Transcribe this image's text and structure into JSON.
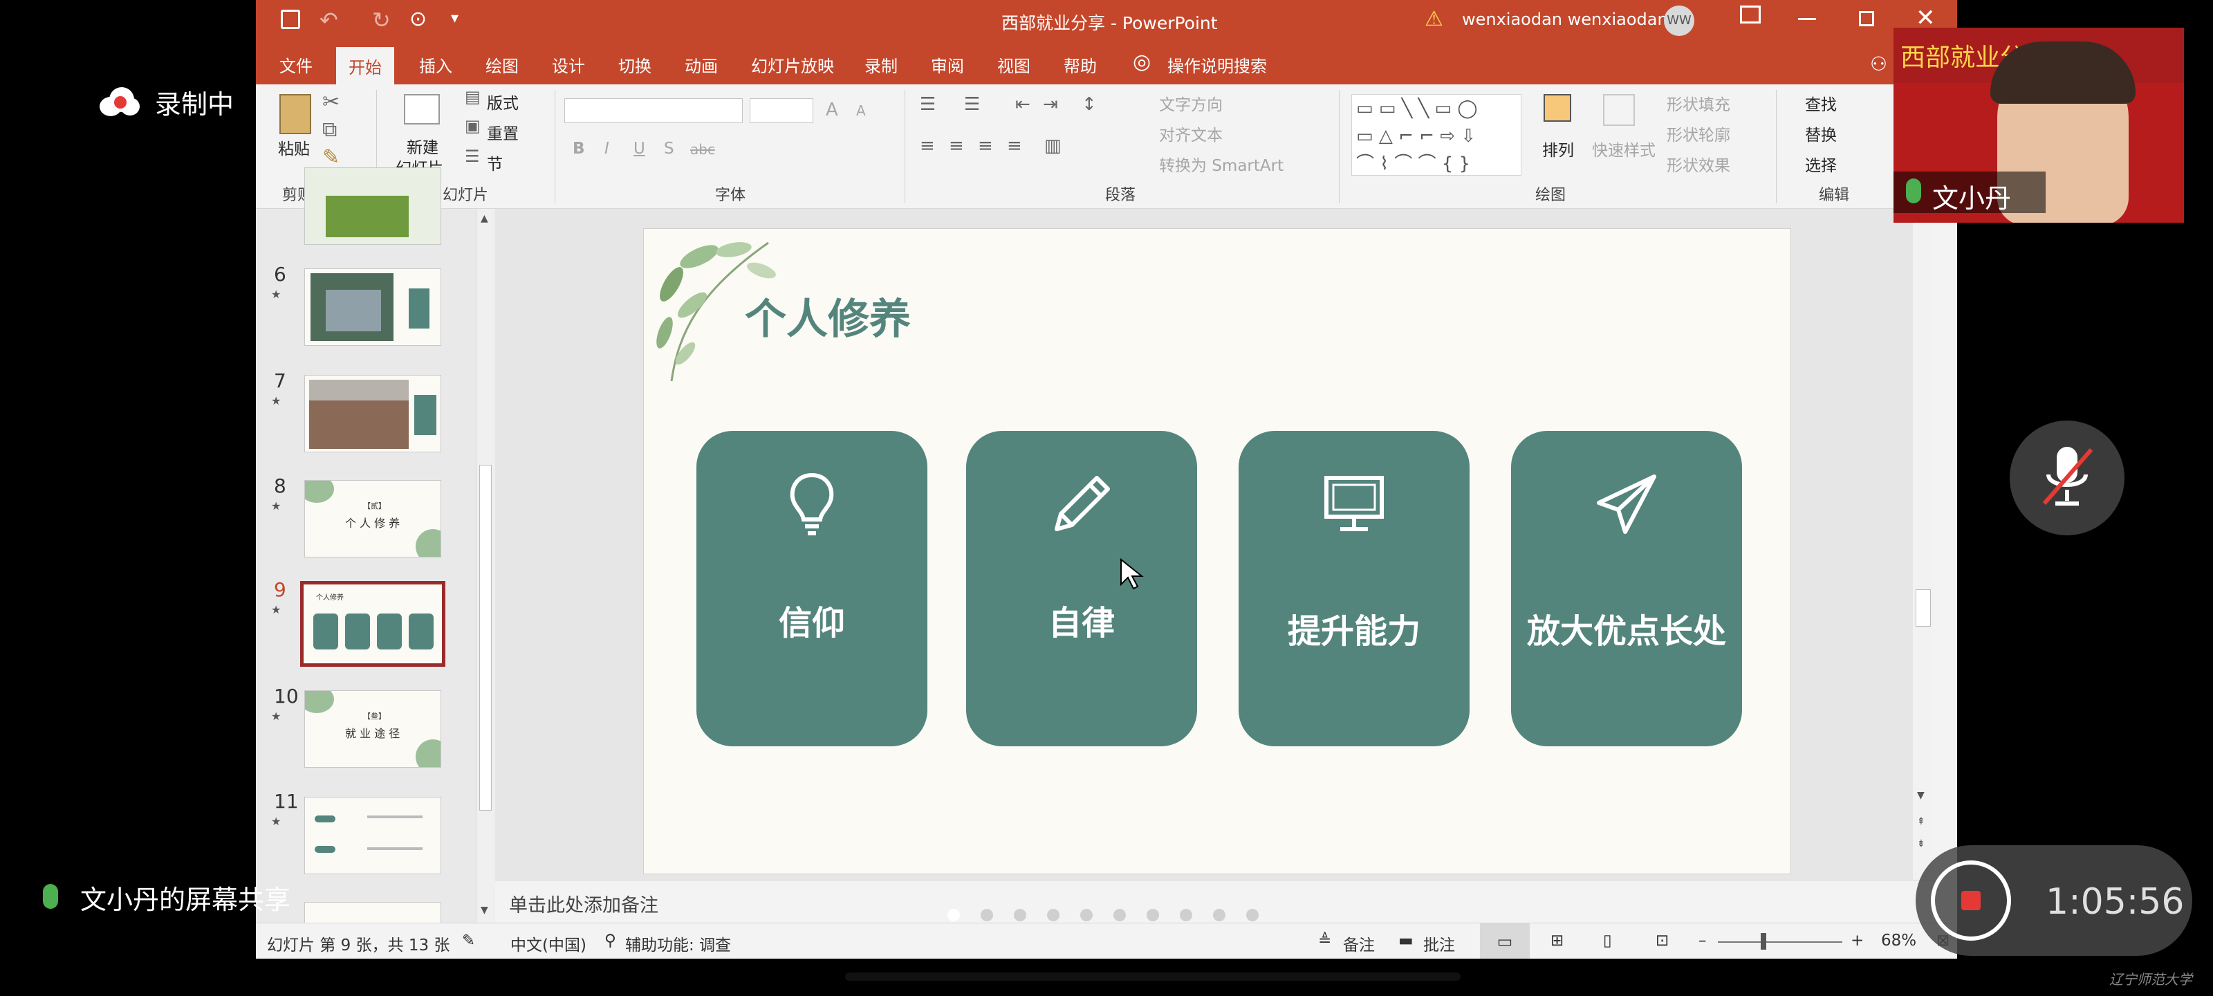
{
  "recording": {
    "label": "录制中"
  },
  "screen_share": {
    "label": "文小丹的屏幕共享"
  },
  "timer": {
    "value": "1:05:56"
  },
  "participant": {
    "name": "文小丹",
    "banner_text": "西部就业分享会"
  },
  "watermark": "辽宁师范大学",
  "window": {
    "title": "西部就业分享 - PowerPoint",
    "user_name": "wenxiaodan wenxiaodan",
    "user_initials": "WW"
  },
  "tabs": [
    "文件",
    "开始",
    "插入",
    "绘图",
    "设计",
    "切换",
    "动画",
    "幻灯片放映",
    "录制",
    "审阅",
    "视图",
    "帮助"
  ],
  "search_label": "操作说明搜索",
  "ribbon": {
    "clipboard": {
      "paste": "粘贴",
      "label": "剪贴板"
    },
    "slides": {
      "new_slide": "新建",
      "new_slide2": "幻灯片",
      "layout": "版式",
      "reset": "重置",
      "section": "节",
      "label": "幻灯片"
    },
    "font": {
      "label": "字体",
      "bold": "B",
      "italic": "I",
      "underline": "U",
      "shadow": "S",
      "strike": "abc",
      "grow": "A",
      "shrink": "A"
    },
    "paragraph": {
      "label": "段落",
      "text_direction": "文字方向",
      "align_text": "对齐文本",
      "smartart": "转换为 SmartArt"
    },
    "drawing": {
      "label": "绘图",
      "arrange": "排列",
      "quick_styles": "快速样式",
      "fill": "形状填充",
      "outline": "形状轮廓",
      "effects": "形状效果"
    },
    "editing": {
      "label": "编辑",
      "find": "查找",
      "replace": "替换",
      "select": "选择"
    }
  },
  "thumbnails": [
    {
      "num": "6"
    },
    {
      "num": "7"
    },
    {
      "num": "8",
      "text_top": "【贰】",
      "text_main": "个 人 修 养"
    },
    {
      "num": "9",
      "selected": true,
      "text_top": "个人修养"
    },
    {
      "num": "10",
      "text_top": "【叁】",
      "text_main": "就 业 途 径"
    },
    {
      "num": "11"
    }
  ],
  "slide": {
    "title": "个人修养",
    "cards": [
      {
        "label": "信仰",
        "icon": "lightbulb-icon"
      },
      {
        "label": "自律",
        "icon": "pencil-icon"
      },
      {
        "label": "提升能力",
        "icon": "monitor-icon"
      },
      {
        "label": "放大优点长处",
        "icon": "paper-plane-icon"
      }
    ],
    "card_color": "#54857d"
  },
  "notes": {
    "placeholder": "单击此处添加备注"
  },
  "statusbar": {
    "slide_info": "幻灯片 第 9 张，共 13 张",
    "language": "中文(中国)",
    "accessibility": "辅助功能: 调查",
    "notes": "备注",
    "comments": "批注",
    "zoom": "68%"
  },
  "colors": {
    "accent": "#c4472c",
    "card": "#54857d",
    "slide_bg": "#fbfaf4"
  }
}
